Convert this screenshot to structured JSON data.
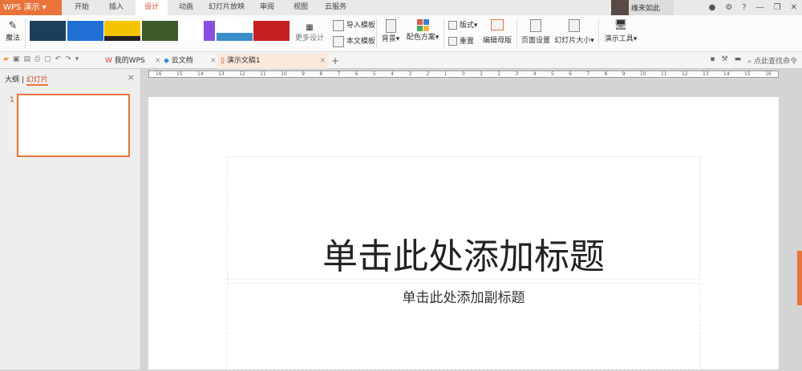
{
  "app": {
    "name": "WPS 演示"
  },
  "menu_tabs": [
    "开始",
    "插入",
    "设计",
    "动画",
    "幻灯片放映",
    "审阅",
    "视图",
    "云服务"
  ],
  "active_tab": "设计",
  "user": {
    "name": "缘来如此"
  },
  "ribbon": {
    "magic": "魔法",
    "more_design": "更多设计",
    "import_template": "导入模板",
    "this_template": "本文模板",
    "background": "背景",
    "color_scheme": "配色方案",
    "layout": "版式",
    "reset": "重置",
    "edit_master": "编辑母版",
    "page_setup": "页面设置",
    "slide_size": "幻灯片大小",
    "tools": "演示工具"
  },
  "doc_tabs": [
    "我的WPS",
    "云文档",
    "演示文稿1"
  ],
  "search_cmd": "点此查找命令",
  "left_panel": {
    "outline": "大纲",
    "slides": "幻灯片",
    "slide_number": "1"
  },
  "ruler": [
    "16",
    "15",
    "14",
    "13",
    "12",
    "11",
    "10",
    "9",
    "8",
    "7",
    "6",
    "5",
    "4",
    "3",
    "2",
    "1",
    "0",
    "1",
    "2",
    "3",
    "4",
    "5",
    "6",
    "7",
    "8",
    "9",
    "10",
    "11",
    "12",
    "13",
    "14",
    "15",
    "16"
  ],
  "slide": {
    "title": "单击此处添加标题",
    "subtitle": "单击此处添加副标题"
  },
  "colors": {
    "accent": "#e8743b"
  }
}
